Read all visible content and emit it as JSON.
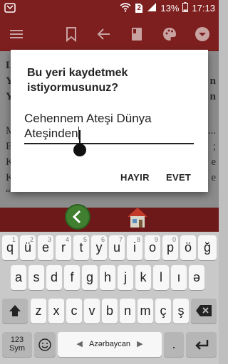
{
  "status_bar": {
    "battery_percent": "13%",
    "time": "17:13",
    "sim_label": "2"
  },
  "content_text": {
    "lines": [
      "L",
      "Y",
      "Y",
      "M",
      "E",
      "K",
      "K",
      "“"
    ],
    "right_fragments": [
      "n",
      "n",
      "...",
      ";",
      "e",
      "e"
    ]
  },
  "dialog": {
    "title": "Bu yeri kaydetmek istiyormusunuz?",
    "input_value_line1": "Cehennem Ateşi Dünya",
    "input_value_line2": "Ateşinden",
    "cancel_label": "HAYIR",
    "confirm_label": "EVET"
  },
  "keyboard": {
    "row1": [
      {
        "key": "q",
        "sub": "1"
      },
      {
        "key": "ü",
        "sub": "2"
      },
      {
        "key": "e",
        "sub": "3"
      },
      {
        "key": "r",
        "sub": "4"
      },
      {
        "key": "t",
        "sub": "5"
      },
      {
        "key": "y",
        "sub": "6"
      },
      {
        "key": "u",
        "sub": "7"
      },
      {
        "key": "i",
        "sub": "8"
      },
      {
        "key": "o",
        "sub": "9"
      },
      {
        "key": "p",
        "sub": "0"
      },
      {
        "key": "ö",
        "sub": ""
      },
      {
        "key": "ğ",
        "sub": ""
      }
    ],
    "row2": [
      "a",
      "s",
      "d",
      "f",
      "g",
      "h",
      "j",
      "k",
      "l",
      "ı",
      "ə"
    ],
    "row3": [
      "z",
      "x",
      "c",
      "v",
      "b",
      "n",
      "m",
      "ç",
      "ş"
    ],
    "sym_label_1": "123",
    "sym_label_2": "Sym",
    "space_label": "Azərbaycan",
    "period_label": "."
  },
  "colors": {
    "app_bar": "#7e1f1f",
    "accent_green": "#3f7f2f"
  }
}
